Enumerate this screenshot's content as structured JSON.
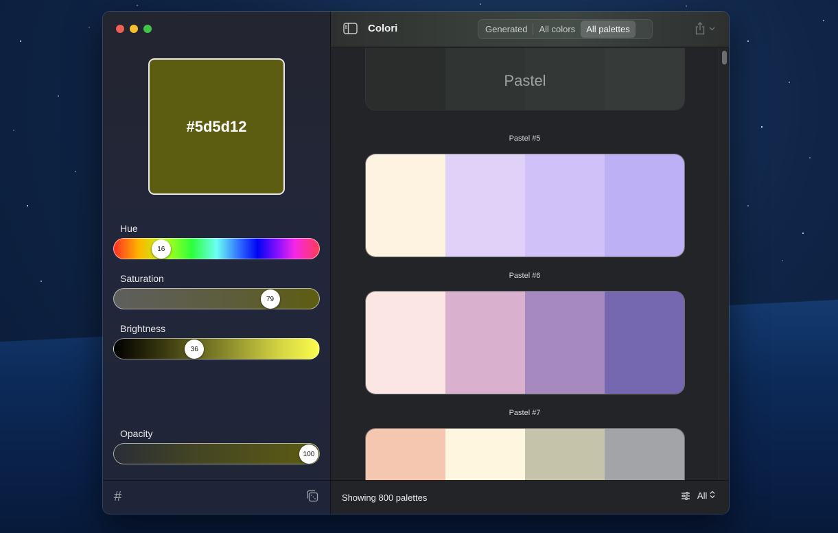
{
  "window": {
    "app_title": "Colori"
  },
  "color": {
    "hex": "#5d5d12",
    "swatch_bg": "#5d5d12"
  },
  "sliders": {
    "hue": {
      "label": "Hue",
      "value": "16",
      "fraction": 0.2
    },
    "saturation": {
      "label": "Saturation",
      "value": "79",
      "fraction": 0.79
    },
    "brightness": {
      "label": "Brightness",
      "value": "36",
      "fraction": 0.38
    },
    "opacity": {
      "label": "Opacity",
      "value": "100",
      "fraction": 1.0
    }
  },
  "sidebar_footer": {
    "hash_icon": "#",
    "dice_icon": "dice-icon"
  },
  "toolbar": {
    "tabs": [
      {
        "label": "Generated",
        "selected": false
      },
      {
        "label": "All colors",
        "selected": false
      },
      {
        "label": "All palettes",
        "selected": true
      }
    ]
  },
  "category": {
    "name": "Pastel",
    "colors": [
      "#2a2d2c",
      "#303432",
      "#333736",
      "#363a39"
    ]
  },
  "palettes": [
    {
      "title": "Pastel #5",
      "colors": [
        "#fdf3e0",
        "#dfd1f8",
        "#d0c2f8",
        "#bdb0f5"
      ]
    },
    {
      "title": "Pastel #6",
      "colors": [
        "#fbe6e4",
        "#dab0cf",
        "#a689bf",
        "#7668b0"
      ]
    },
    {
      "title": "Pastel #7",
      "colors": [
        "#f6c7b0",
        "#fff6e0",
        "#c5c4ab",
        "#a3a4a8"
      ]
    }
  ],
  "footer": {
    "count_text": "Showing 800 palettes",
    "filter_label": "All"
  }
}
